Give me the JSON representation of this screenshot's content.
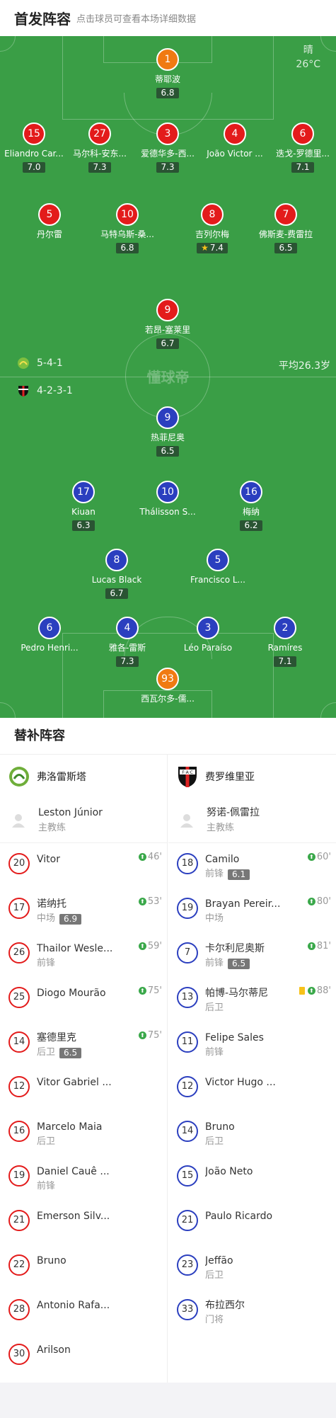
{
  "header": {
    "title": "首发阵容",
    "subtitle": "点击球员可查看本场详细数据"
  },
  "pitch": {
    "weather": "晴",
    "temperature": "26°C",
    "watermark": "懂球帝",
    "home_formation": "5-4-1",
    "away_formation": "4-2-3-1",
    "avg_age": "平均26.3岁"
  },
  "home_players": [
    {
      "num": "1",
      "name": "蒂耶波",
      "rating": "6.8",
      "gk": true
    },
    {
      "num": "15",
      "name": "Eliandro Car...",
      "rating": "7.0",
      "sub": "75'"
    },
    {
      "num": "27",
      "name": "马尔科-安东...",
      "rating": "7.3"
    },
    {
      "num": "3",
      "name": "爱德华多-西...",
      "rating": "7.3"
    },
    {
      "num": "4",
      "name": "João Victor ...",
      "rating": ""
    },
    {
      "num": "6",
      "name": "迭戈-罗德里...",
      "rating": "7.1"
    },
    {
      "num": "5",
      "name": "丹尔雷",
      "rating": ""
    },
    {
      "num": "10",
      "name": "马特乌斯-桑...",
      "rating": "6.8",
      "sub": "53'",
      "captain": true
    },
    {
      "num": "8",
      "name": "吉列尔梅",
      "rating": "7.4",
      "sub": "75'",
      "star": true
    },
    {
      "num": "7",
      "name": "佛斯麦-费雷拉",
      "rating": "6.5",
      "sub": "46'"
    },
    {
      "num": "9",
      "name": "若昂-塞莱里",
      "rating": "6.7",
      "sub": "59'"
    }
  ],
  "away_players": [
    {
      "num": "9",
      "name": "热菲尼奥",
      "rating": "6.5",
      "sub": "60'"
    },
    {
      "num": "17",
      "name": "Kiuan",
      "rating": "6.3",
      "sub": "81'"
    },
    {
      "num": "10",
      "name": "Thálisson S...",
      "rating": ""
    },
    {
      "num": "16",
      "name": "梅纳",
      "rating": "6.2"
    },
    {
      "num": "8",
      "name": "Lucas Black",
      "rating": "6.7"
    },
    {
      "num": "5",
      "name": "Francisco L...",
      "rating": "",
      "sub": "80'"
    },
    {
      "num": "6",
      "name": "Pedro Henri...",
      "rating": "",
      "sub": "88'"
    },
    {
      "num": "4",
      "name": "雅各-雷斯",
      "rating": "7.3"
    },
    {
      "num": "3",
      "name": "Léo Paraíso",
      "rating": "",
      "captain": true
    },
    {
      "num": "2",
      "name": "Ramíres",
      "rating": "7.1"
    },
    {
      "num": "93",
      "name": "西瓦尔多-儒...",
      "rating": "",
      "gk": true
    }
  ],
  "subs": {
    "title": "替补阵容",
    "home": {
      "team": "弗洛雷斯塔",
      "coach": {
        "name": "Leston Júnior",
        "role": "主教练"
      },
      "players": [
        {
          "num": "20",
          "name": "Vitor",
          "pos": "",
          "rating": "",
          "time": "46'"
        },
        {
          "num": "17",
          "name": "诺纳托",
          "pos": "中场",
          "rating": "6.9",
          "time": "53'"
        },
        {
          "num": "26",
          "name": "Thailor Wesle...",
          "pos": "前锋",
          "rating": "",
          "time": "59'"
        },
        {
          "num": "25",
          "name": "Diogo Mourão",
          "pos": "",
          "rating": "",
          "time": "75'"
        },
        {
          "num": "14",
          "name": "塞德里克",
          "pos": "后卫",
          "rating": "6.5",
          "time": "75'"
        },
        {
          "num": "12",
          "name": "Vitor Gabriel ...",
          "pos": "",
          "rating": "",
          "time": ""
        },
        {
          "num": "16",
          "name": "Marcelo Maia",
          "pos": "后卫",
          "rating": "",
          "time": ""
        },
        {
          "num": "19",
          "name": "Daniel Cauê ...",
          "pos": "前锋",
          "rating": "",
          "time": ""
        },
        {
          "num": "21",
          "name": "Emerson Silv...",
          "pos": "",
          "rating": "",
          "time": ""
        },
        {
          "num": "22",
          "name": "Bruno",
          "pos": "",
          "rating": "",
          "time": ""
        },
        {
          "num": "28",
          "name": "Antonio Rafa...",
          "pos": "",
          "rating": "",
          "time": ""
        },
        {
          "num": "30",
          "name": "Arilson",
          "pos": "",
          "rating": "",
          "time": ""
        }
      ]
    },
    "away": {
      "team": "费罗维里亚",
      "coach": {
        "name": "努诺-佩雷拉",
        "role": "主教练"
      },
      "players": [
        {
          "num": "18",
          "name": "Camilo",
          "pos": "前锋",
          "rating": "6.1",
          "time": "60'"
        },
        {
          "num": "19",
          "name": "Brayan Pereir...",
          "pos": "中场",
          "rating": "",
          "time": "80'"
        },
        {
          "num": "7",
          "name": "卡尔利尼奥斯",
          "pos": "前锋",
          "rating": "6.5",
          "time": "81'"
        },
        {
          "num": "13",
          "name": "帕博-马尔蒂尼",
          "pos": "后卫",
          "rating": "",
          "time": "88'",
          "yellow": true
        },
        {
          "num": "11",
          "name": "Felipe Sales",
          "pos": "前锋",
          "rating": "",
          "time": ""
        },
        {
          "num": "12",
          "name": "Victor Hugo ...",
          "pos": "",
          "rating": "",
          "time": ""
        },
        {
          "num": "14",
          "name": "Bruno",
          "pos": "后卫",
          "rating": "",
          "time": ""
        },
        {
          "num": "15",
          "name": "João Neto",
          "pos": "",
          "rating": "",
          "time": ""
        },
        {
          "num": "21",
          "name": "Paulo Ricardo",
          "pos": "",
          "rating": "",
          "time": ""
        },
        {
          "num": "23",
          "name": "Jeffão",
          "pos": "后卫",
          "rating": "",
          "time": ""
        },
        {
          "num": "33",
          "name": "布拉西尔",
          "pos": "门将",
          "rating": "",
          "time": ""
        }
      ]
    }
  },
  "colors": {
    "pitch": "#3a9e46",
    "home": "#e31b1b",
    "away": "#2b3fbf",
    "gk": "#f07a12"
  }
}
